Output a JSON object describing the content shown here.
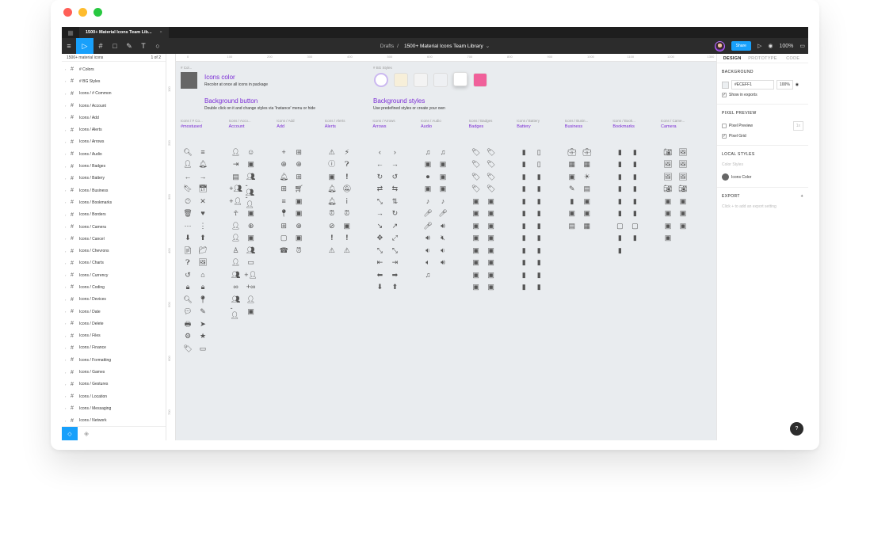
{
  "window": {
    "dot_colors": [
      "#ff5f57",
      "#febc2e",
      "#28c840"
    ]
  },
  "tabbar": {
    "tab_label": "1500+ Material Icons Team Lib...",
    "close": "×",
    "grid_icon": "▦"
  },
  "toolbar": {
    "menu_icon": "≡",
    "move_icon": "▷",
    "frame_icon": "#",
    "shape_icon": "□",
    "pen_icon": "✎",
    "text_icon": "T",
    "comment_icon": "○",
    "breadcrumb_parent": "Drafts",
    "separator": "/",
    "file_title": "1500+ Material Icons Team Library",
    "title_caret": "⌄",
    "share_label": "Share",
    "present_icon": "▷",
    "view_icon": "◉",
    "zoom": "100%",
    "library_icon": "▭"
  },
  "left_panel": {
    "page_name": "1500+ material icons",
    "page_count": "1 of 2",
    "layers": [
      "# Colors",
      "# BG Styles",
      "Icons / # Common",
      "Icons / Account",
      "Icons / Add",
      "Icons / Alerts",
      "Icons / Arrows",
      "Icons / Audio",
      "Icons / Badges",
      "Icons / Battery",
      "Icons / Business",
      "Icons / Bookmarks",
      "Icons / Borders",
      "Icons / Camera",
      "Icons / Cancel",
      "Icons / Chevrons",
      "Icons / Charts",
      "Icons / Currency",
      "Icons / Coding",
      "Icons / Devices",
      "Icons / Date",
      "Icons / Delete",
      "Icons / Files",
      "Icons / Finance",
      "Icons / Formatting",
      "Icons / Games",
      "Icons / Gestures",
      "Icons / Location",
      "Icons / Messaging",
      "Icons / Network"
    ],
    "layer_caret": "›",
    "frame_glyph": "#",
    "bottom_layers_icon": "◇",
    "bottom_assets_icon": "◈"
  },
  "canvas": {
    "ruler_top": [
      "0",
      "100",
      "200",
      "300",
      "400",
      "500",
      "600",
      "700",
      "800",
      "900",
      "1000",
      "1100",
      "1200",
      "1300"
    ],
    "ruler_left": [
      "100",
      "200",
      "300",
      "400",
      "500",
      "600",
      "700"
    ],
    "colors_label": "# Col...",
    "icons_color_title": "Icons color",
    "icons_color_desc": "Recolor at once all icons in package",
    "bg_button_title": "Background button",
    "bg_button_desc": "Double click on it and change styles via 'Instance' menu or hide",
    "bg_styles_label": "# BG Styles",
    "bg_styles_title": "Background styles",
    "bg_styles_desc": "Use predefined styles or create your own",
    "bg_swatches": [
      "#ffffff",
      "#f7efd9",
      "#f3f3f3",
      "#eef0f3",
      "#ffffff",
      "#f0609a"
    ],
    "columns": [
      {
        "small": "Icons / # Co...",
        "name": "#mostused",
        "icons": [
          "🔍︎",
          "≡",
          "👤︎",
          "🔔︎",
          "←",
          "→",
          "🔖︎",
          "📅︎",
          "🕒︎",
          "✕",
          "🗑︎",
          "♥",
          "⋯",
          "⋮",
          "⬇",
          "⬆",
          "📄︎",
          "📁︎",
          "❓︎",
          "🖼︎",
          "↺",
          "⌂",
          "🔒︎",
          "🔒︎",
          "🔍︎",
          "📍︎",
          "💬︎",
          "✎",
          "🖶",
          "➤",
          "⚙︎",
          "★",
          "🏷︎",
          "▭"
        ]
      },
      {
        "small": "Icons / Acco...",
        "name": "Account",
        "icons": [
          "👤︎",
          "☺",
          "⇥",
          "▣",
          "▤",
          "👥︎",
          "+👥︎",
          "-👥︎",
          "+👤︎",
          "-👤︎",
          "☥",
          "▣",
          "👤︎",
          "⊕",
          "👤︎",
          "▣",
          "♙",
          "👥︎",
          "👤︎",
          "▭",
          "👥︎",
          "+👤︎",
          "∞",
          "+∞",
          "👥︎",
          "👤︎",
          "-👤︎",
          "▣"
        ]
      },
      {
        "small": "Icons / Add",
        "name": "Add",
        "icons": [
          "+",
          "⊞",
          "⊕",
          "⊕",
          "🔔︎",
          "⊞",
          "⊞",
          "🛒︎",
          "≡",
          "▣",
          "📍︎",
          "▣",
          "⊞",
          "⊕",
          "▢",
          "▣",
          "☎",
          "⏰︎"
        ]
      },
      {
        "small": "Icons / Alerts",
        "name": "Alerts",
        "icons": [
          "⚠︎",
          "⚡︎",
          "ⓘ",
          "❓︎",
          "▣",
          "❗︎",
          "🔔︎",
          "🔕︎",
          "🔔︎",
          "ⅰ",
          "⏰︎",
          "⏰︎",
          "⊘",
          "▣",
          "❗︎",
          "❗︎",
          "⚠︎",
          "⚠︎"
        ]
      },
      {
        "small": "Icons / Arrows",
        "name": "Arrows",
        "icons": [
          "‹",
          "›",
          "←",
          "→",
          "↻",
          "↺",
          "⇄",
          "⇆",
          "⤡",
          "⇅",
          "→",
          "↻",
          "↘",
          "↗",
          "✥",
          "⤢",
          "⤡",
          "⤡",
          "⇤",
          "⇥",
          "⬅",
          "➡",
          "⬇",
          "⬆"
        ]
      },
      {
        "small": "Icons / Audio",
        "name": "Audio",
        "icons": [
          "♫",
          "♫",
          "▣",
          "▣",
          "⏺︎",
          "▣",
          "▣",
          "▣",
          "♪",
          "♪",
          "🎤︎",
          "🎤︎",
          "🎤︎",
          "🔊︎",
          "🔊︎",
          "🔇︎",
          "🔉︎",
          "🔉︎",
          "🔈︎",
          "🔊︎",
          "♫"
        ]
      },
      {
        "small": "Icons / Badges",
        "name": "Badges",
        "icons": [
          "🏷︎",
          "🏷︎",
          "🏷︎",
          "🏷︎",
          "🏷︎",
          "🏷︎",
          "🏷︎",
          "🏷︎",
          "▣",
          "▣",
          "▣",
          "▣",
          "▣",
          "▣",
          "▣",
          "▣",
          "▣",
          "▣",
          "▣",
          "▣",
          "▣",
          "▣",
          "▣",
          "▣"
        ]
      },
      {
        "small": "Icons / Battery",
        "name": "Battery",
        "icons": [
          "▮",
          "▯",
          "▮",
          "▯",
          "▮",
          "▮",
          "▮",
          "▮",
          "▮",
          "▮",
          "▮",
          "▮",
          "▮",
          "▮",
          "▮",
          "▮",
          "▮",
          "▮",
          "▮",
          "▮",
          "▮",
          "▮",
          "▮",
          "▮"
        ]
      },
      {
        "small": "Icons / Busin...",
        "name": "Business",
        "icons": [
          "💼︎",
          "💼︎",
          "▦",
          "▦",
          "▣",
          "☀",
          "✎",
          "▤",
          "▮",
          "▣",
          "▣",
          "▣",
          "▤",
          "▦"
        ]
      },
      {
        "small": "Icons / Book...",
        "name": "Bookmarks",
        "icons": [
          "▮",
          "▮",
          "▮",
          "▮",
          "▮",
          "▮",
          "▮",
          "▮",
          "▮",
          "▮",
          "▮",
          "▮",
          "▢",
          "▢",
          "▮",
          "▮",
          "▮"
        ]
      },
      {
        "small": "Icons / Came...",
        "name": "Camera",
        "icons": [
          "📷︎",
          "🖼︎",
          "🖼︎",
          "🖼︎",
          "🖼︎",
          "🖼︎",
          "📷︎",
          "📷︎",
          "▣",
          "▣",
          "▣",
          "▣",
          "▣",
          "▣",
          "▣"
        ]
      }
    ]
  },
  "right_panel": {
    "tabs": [
      "DESIGN",
      "PROTOTYPE",
      "CODE"
    ],
    "background_head": "BACKGROUND",
    "bg_hex": "#ECEFF1",
    "bg_pct": "100%",
    "bg_color": "#eceff1",
    "eye_icon": "◉",
    "show_in_exports": "Show in exports",
    "check": "✓",
    "pixel_preview_head": "PIXEL PREVIEW",
    "pixel_preview": "Pixel Preview",
    "pixel_preview_val": "1x",
    "pixel_grid": "Pixel Grid",
    "local_styles_head": "LOCAL STYLES",
    "color_styles": "Color Styles",
    "icons_color": "Icons Color",
    "export_head": "EXPORT",
    "export_plus": "+",
    "export_hint": "Click + to add an export setting",
    "help": "?"
  }
}
